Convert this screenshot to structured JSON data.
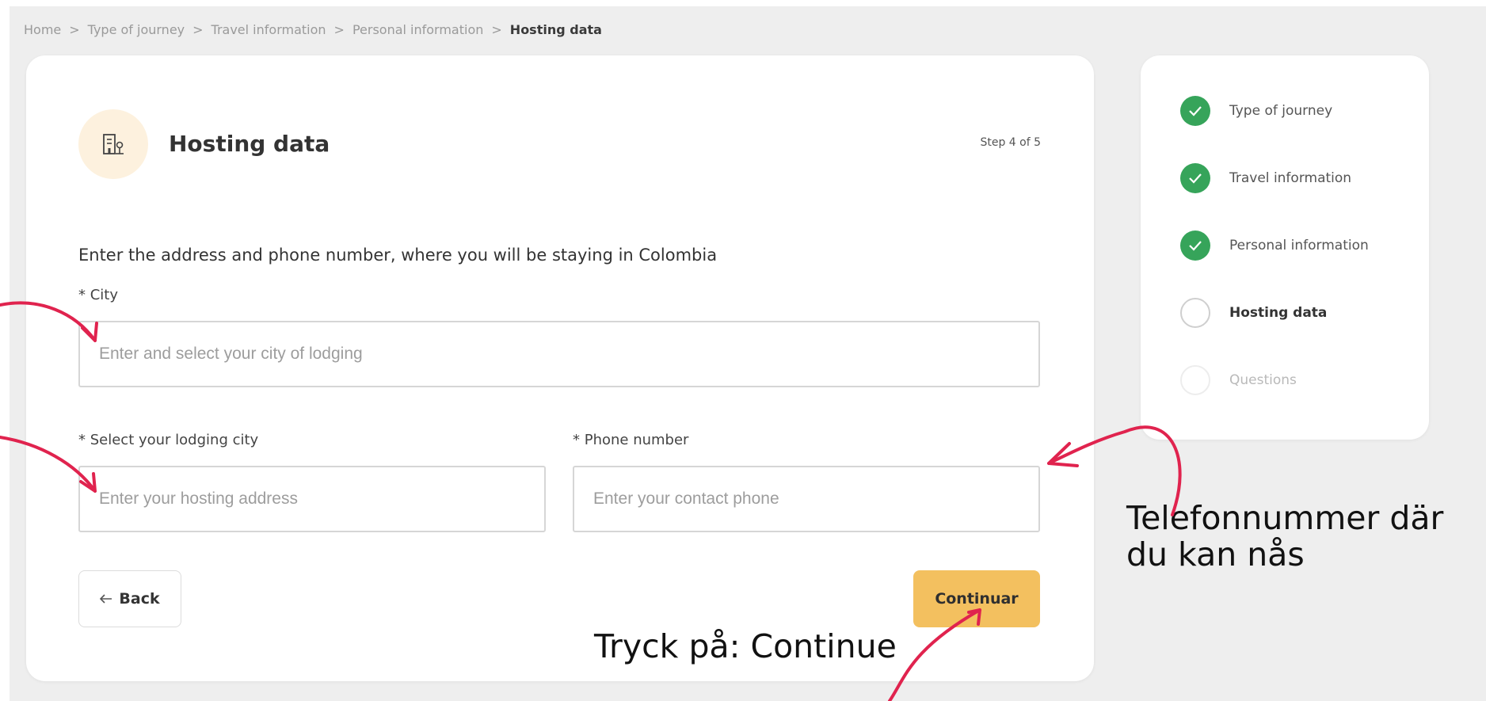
{
  "breadcrumb": {
    "items": [
      "Home",
      "Type of journey",
      "Travel information",
      "Personal information"
    ],
    "current": "Hosting data",
    "separator": ">"
  },
  "card": {
    "icon": "building-icon",
    "title": "Hosting data",
    "step": "Step 4 of 5",
    "instructions": "Enter the address and phone number, where you will be staying in Colombia"
  },
  "form": {
    "city": {
      "label": "* City",
      "placeholder": "Enter and select your city of lodging",
      "value": ""
    },
    "address": {
      "label": "* Select your lodging city",
      "placeholder": "Enter your hosting address",
      "value": ""
    },
    "phone": {
      "label": "* Phone number",
      "placeholder": "Enter your contact phone",
      "value": ""
    }
  },
  "buttons": {
    "back": "Back",
    "back_icon": "arrow-left-icon",
    "continue": "Continuar"
  },
  "steps": [
    {
      "label": "Type of journey",
      "status": "done"
    },
    {
      "label": "Travel information",
      "status": "done"
    },
    {
      "label": "Personal information",
      "status": "done"
    },
    {
      "label": "Hosting data",
      "status": "active"
    },
    {
      "label": "Questions",
      "status": "pending"
    }
  ],
  "annotations": {
    "phone_line1": "Telefonnummer där",
    "phone_line2": "du kan nås",
    "continue_note": "Tryck på: Continue"
  },
  "colors": {
    "background": "#eeeeee",
    "accent": "#f3c05f",
    "success": "#36a45a",
    "annotation_arrow": "#e0234e"
  }
}
